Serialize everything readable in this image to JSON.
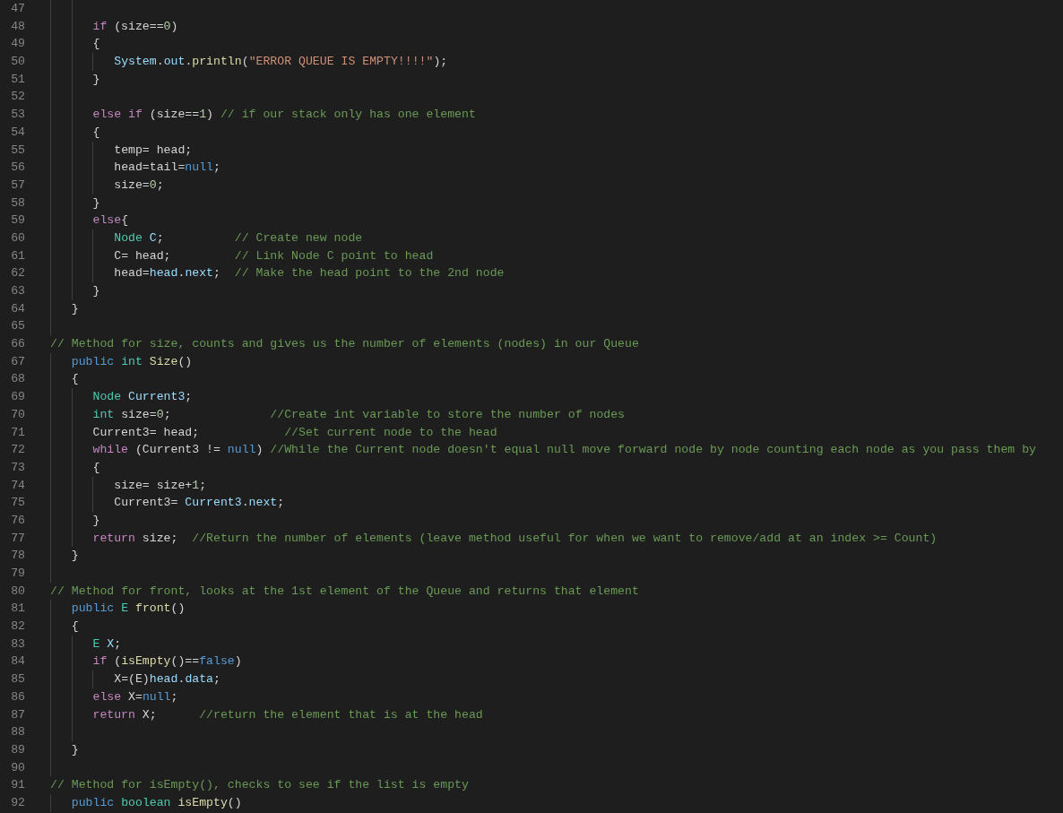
{
  "editor": {
    "lines": [
      {
        "children": [
          {
            "children": [
              {
                "number": "47"
              },
              {
                "number": "48",
                "tokens": [
                  {
                    "kind": "keyword",
                    "text": "if"
                  },
                  {
                    "kind": "plain",
                    "text": " (size=="
                  },
                  {
                    "kind": "number",
                    "text": "0"
                  },
                  {
                    "kind": "plain",
                    "text": ")"
                  }
                ]
              },
              {
                "number": "49",
                "tokens": [
                  {
                    "kind": "plain",
                    "text": "{"
                  }
                ],
                "children": [
                  {
                    "number": "50",
                    "tokens": [
                      {
                        "kind": "variable",
                        "text": "System"
                      },
                      {
                        "kind": "plain",
                        "text": "."
                      },
                      {
                        "kind": "variable",
                        "text": "out"
                      },
                      {
                        "kind": "plain",
                        "text": "."
                      },
                      {
                        "kind": "function",
                        "text": "println"
                      },
                      {
                        "kind": "plain",
                        "text": "("
                      },
                      {
                        "kind": "string",
                        "text": "\"ERROR QUEUE IS EMPTY!!!!\""
                      },
                      {
                        "kind": "plain",
                        "text": ");"
                      }
                    ]
                  }
                ]
              },
              {
                "number": "51",
                "tokens": [
                  {
                    "kind": "plain",
                    "text": "}"
                  }
                ]
              },
              {
                "number": "52"
              },
              {
                "number": "53",
                "tokens": [
                  {
                    "kind": "keyword",
                    "text": "else "
                  },
                  {
                    "kind": "keyword",
                    "text": "if"
                  },
                  {
                    "kind": "plain",
                    "text": " (size=="
                  },
                  {
                    "kind": "number",
                    "text": "1"
                  },
                  {
                    "kind": "plain",
                    "text": ") "
                  },
                  {
                    "kind": "comment",
                    "text": "// if our stack only has one element"
                  }
                ]
              },
              {
                "number": "54",
                "tokens": [
                  {
                    "kind": "plain",
                    "text": "{"
                  }
                ],
                "children": [
                  {
                    "number": "55",
                    "tokens": [
                      {
                        "kind": "plain",
                        "text": "temp= head;"
                      }
                    ]
                  },
                  {
                    "number": "56",
                    "tokens": [
                      {
                        "kind": "plain",
                        "text": "head=tail="
                      },
                      {
                        "kind": "modifier",
                        "text": "null"
                      },
                      {
                        "kind": "plain",
                        "text": ";"
                      }
                    ]
                  },
                  {
                    "number": "57",
                    "tokens": [
                      {
                        "kind": "plain",
                        "text": "size="
                      },
                      {
                        "kind": "number",
                        "text": "0"
                      },
                      {
                        "kind": "plain",
                        "text": ";"
                      }
                    ]
                  }
                ]
              },
              {
                "number": "58",
                "tokens": [
                  {
                    "kind": "plain",
                    "text": "}"
                  }
                ]
              },
              {
                "number": "59",
                "tokens": [
                  {
                    "kind": "keyword",
                    "text": "else"
                  },
                  {
                    "kind": "plain",
                    "text": "{"
                  }
                ],
                "children": [
                  {
                    "number": "60",
                    "tokens": [
                      {
                        "kind": "type",
                        "text": "Node "
                      },
                      {
                        "kind": "variable",
                        "text": "C"
                      },
                      {
                        "kind": "plain",
                        "text": ";          "
                      },
                      {
                        "kind": "comment",
                        "text": "// Create new node"
                      }
                    ]
                  },
                  {
                    "number": "61",
                    "tokens": [
                      {
                        "kind": "plain",
                        "text": "C= head;         "
                      },
                      {
                        "kind": "comment",
                        "text": "// Link Node C point to head"
                      }
                    ]
                  },
                  {
                    "number": "62",
                    "tokens": [
                      {
                        "kind": "plain",
                        "text": "head="
                      },
                      {
                        "kind": "variable",
                        "text": "head"
                      },
                      {
                        "kind": "plain",
                        "text": "."
                      },
                      {
                        "kind": "variable",
                        "text": "next"
                      },
                      {
                        "kind": "plain",
                        "text": ";  "
                      },
                      {
                        "kind": "comment",
                        "text": "// Make the head point to the 2nd node"
                      }
                    ]
                  }
                ]
              },
              {
                "number": "63",
                "tokens": [
                  {
                    "kind": "plain",
                    "text": "}"
                  }
                ]
              }
            ]
          },
          {
            "number": "64",
            "tokens": [
              {
                "kind": "plain",
                "text": "}"
              }
            ]
          },
          {
            "number": "65"
          }
        ]
      },
      {
        "number": "66",
        "tokens": [
          {
            "kind": "comment",
            "text": "// Method for size, counts and gives us the number of elements (nodes) in our Queue"
          }
        ],
        "children": [
          {
            "number": "67",
            "tokens": [
              {
                "kind": "modifier",
                "text": "public "
              },
              {
                "kind": "type",
                "text": "int "
              },
              {
                "kind": "function",
                "text": "Size"
              },
              {
                "kind": "plain",
                "text": "()"
              }
            ]
          },
          {
            "number": "68",
            "tokens": [
              {
                "kind": "plain",
                "text": "{"
              }
            ],
            "children": [
              {
                "number": "69",
                "tokens": [
                  {
                    "kind": "type",
                    "text": "Node "
                  },
                  {
                    "kind": "variable",
                    "text": "Current3"
                  },
                  {
                    "kind": "plain",
                    "text": ";"
                  }
                ]
              },
              {
                "number": "70",
                "tokens": [
                  {
                    "kind": "type",
                    "text": "int"
                  },
                  {
                    "kind": "plain",
                    "text": " size="
                  },
                  {
                    "kind": "number",
                    "text": "0"
                  },
                  {
                    "kind": "plain",
                    "text": ";              "
                  },
                  {
                    "kind": "comment",
                    "text": "//Create int variable to store the number of nodes"
                  }
                ]
              },
              {
                "number": "71",
                "tokens": [
                  {
                    "kind": "plain",
                    "text": "Current3= head;            "
                  },
                  {
                    "kind": "comment",
                    "text": "//Set current node to the head"
                  }
                ]
              },
              {
                "number": "72",
                "tokens": [
                  {
                    "kind": "keyword",
                    "text": "while"
                  },
                  {
                    "kind": "plain",
                    "text": " (Current3 != "
                  },
                  {
                    "kind": "modifier",
                    "text": "null"
                  },
                  {
                    "kind": "plain",
                    "text": ") "
                  },
                  {
                    "kind": "comment",
                    "text": "//While the Current node doesn't equal null move forward node by node counting each node as you pass them by"
                  }
                ]
              },
              {
                "number": "73",
                "tokens": [
                  {
                    "kind": "plain",
                    "text": "{"
                  }
                ],
                "children": [
                  {
                    "number": "74",
                    "tokens": [
                      {
                        "kind": "plain",
                        "text": "size= size+"
                      },
                      {
                        "kind": "number",
                        "text": "1"
                      },
                      {
                        "kind": "plain",
                        "text": ";"
                      }
                    ]
                  },
                  {
                    "number": "75",
                    "tokens": [
                      {
                        "kind": "plain",
                        "text": "Current3= "
                      },
                      {
                        "kind": "variable",
                        "text": "Current3"
                      },
                      {
                        "kind": "plain",
                        "text": "."
                      },
                      {
                        "kind": "variable",
                        "text": "next"
                      },
                      {
                        "kind": "plain",
                        "text": ";"
                      }
                    ]
                  }
                ]
              },
              {
                "number": "76",
                "tokens": [
                  {
                    "kind": "plain",
                    "text": "}"
                  }
                ]
              },
              {
                "number": "77",
                "tokens": [
                  {
                    "kind": "keyword",
                    "text": "return"
                  },
                  {
                    "kind": "plain",
                    "text": " size;  "
                  },
                  {
                    "kind": "comment",
                    "text": "//Return the number of elements (leave method useful for when we want to remove/add at an index >= Count)"
                  }
                ]
              }
            ]
          },
          {
            "number": "78",
            "tokens": [
              {
                "kind": "plain",
                "text": "}"
              }
            ]
          },
          {
            "number": "79"
          }
        ]
      },
      {
        "number": "80",
        "tokens": [
          {
            "kind": "comment",
            "text": "// Method for front, looks at the 1st element of the Queue and returns that element"
          }
        ],
        "children": [
          {
            "number": "81",
            "tokens": [
              {
                "kind": "modifier",
                "text": "public "
              },
              {
                "kind": "type",
                "text": "E "
              },
              {
                "kind": "function",
                "text": "front"
              },
              {
                "kind": "plain",
                "text": "()"
              }
            ]
          },
          {
            "number": "82",
            "tokens": [
              {
                "kind": "plain",
                "text": "{"
              }
            ],
            "children": [
              {
                "number": "83",
                "tokens": [
                  {
                    "kind": "type",
                    "text": "E "
                  },
                  {
                    "kind": "variable",
                    "text": "X"
                  },
                  {
                    "kind": "plain",
                    "text": ";"
                  }
                ]
              },
              {
                "number": "84",
                "tokens": [
                  {
                    "kind": "keyword",
                    "text": "if"
                  },
                  {
                    "kind": "plain",
                    "text": " ("
                  },
                  {
                    "kind": "function",
                    "text": "isEmpty"
                  },
                  {
                    "kind": "plain",
                    "text": "()=="
                  },
                  {
                    "kind": "modifier",
                    "text": "false"
                  },
                  {
                    "kind": "plain",
                    "text": ")"
                  }
                ],
                "children": [
                  {
                    "number": "85",
                    "tokens": [
                      {
                        "kind": "plain",
                        "text": "X=(E)"
                      },
                      {
                        "kind": "variable",
                        "text": "head"
                      },
                      {
                        "kind": "plain",
                        "text": "."
                      },
                      {
                        "kind": "variable",
                        "text": "data"
                      },
                      {
                        "kind": "plain",
                        "text": ";"
                      }
                    ]
                  }
                ]
              },
              {
                "number": "86",
                "tokens": [
                  {
                    "kind": "keyword",
                    "text": "else"
                  },
                  {
                    "kind": "plain",
                    "text": " X="
                  },
                  {
                    "kind": "modifier",
                    "text": "null"
                  },
                  {
                    "kind": "plain",
                    "text": ";"
                  }
                ]
              },
              {
                "number": "87",
                "tokens": [
                  {
                    "kind": "keyword",
                    "text": "return"
                  },
                  {
                    "kind": "plain",
                    "text": " X;      "
                  },
                  {
                    "kind": "comment",
                    "text": "//return the element that is at the head"
                  }
                ]
              },
              {
                "number": "88"
              }
            ]
          },
          {
            "number": "89",
            "tokens": [
              {
                "kind": "plain",
                "text": "}"
              }
            ]
          },
          {
            "number": "90"
          }
        ]
      },
      {
        "number": "91",
        "tokens": [
          {
            "kind": "comment",
            "text": "// Method for isEmpty(), checks to see if the list is empty"
          }
        ],
        "children": [
          {
            "number": "92",
            "tokens": [
              {
                "kind": "modifier",
                "text": "public "
              },
              {
                "kind": "type",
                "text": "boolean "
              },
              {
                "kind": "function",
                "text": "isEmpty"
              },
              {
                "kind": "plain",
                "text": "()"
              }
            ]
          }
        ]
      }
    ]
  }
}
